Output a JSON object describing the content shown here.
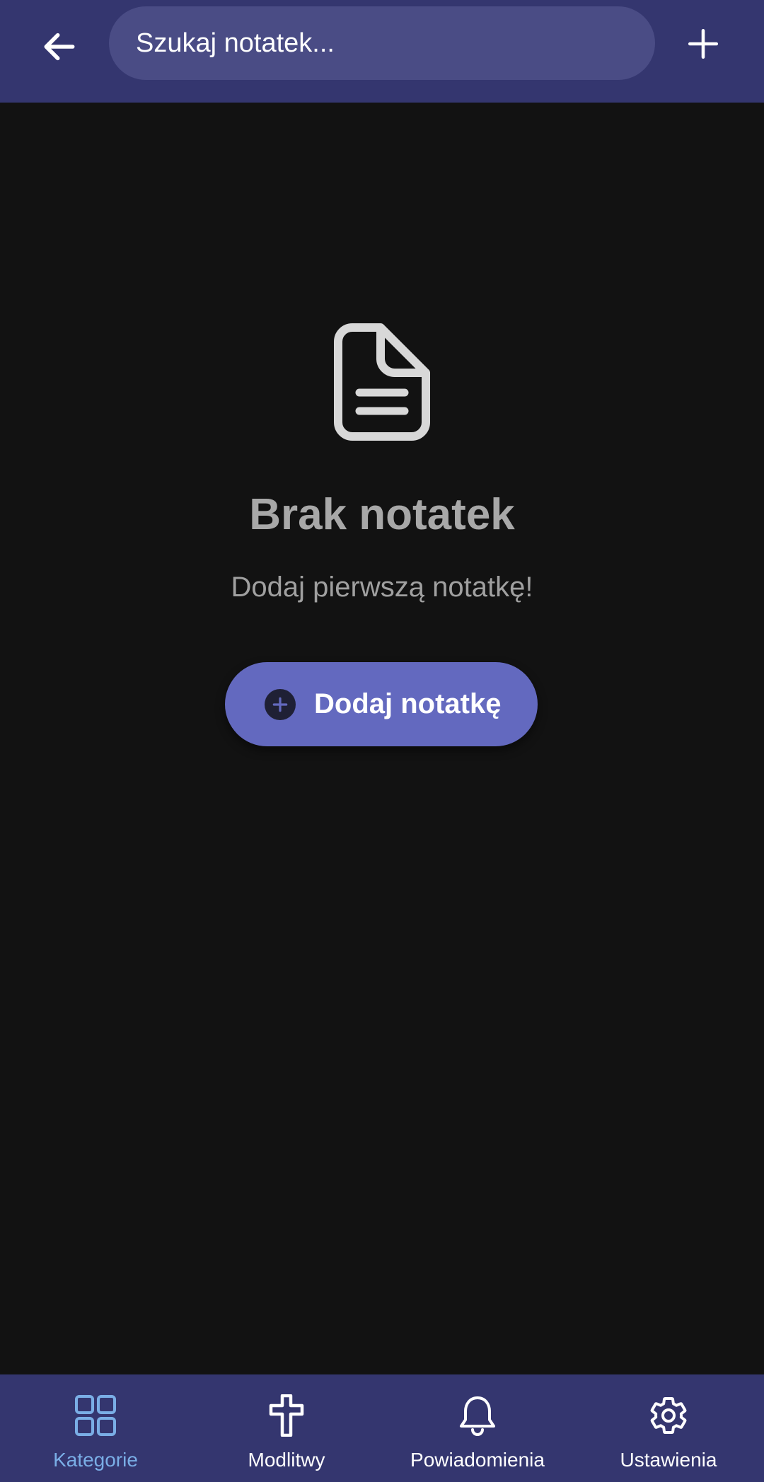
{
  "header": {
    "search_placeholder": "Szukaj notatek...",
    "background": "#34366f",
    "search_background": "#4a4c85",
    "icons": {
      "back": "arrow-left-icon",
      "add": "plus-icon"
    }
  },
  "empty_state": {
    "icon": "document-icon",
    "title": "Brak notatek",
    "subtitle": "Dodaj pierwszą notatkę!",
    "button_label": "Dodaj notatkę",
    "button_color": "#6369bf"
  },
  "bottom_nav": {
    "active_color": "#7aaee6",
    "items": [
      {
        "label": "Kategorie",
        "icon": "grid-icon",
        "active": true
      },
      {
        "label": "Modlitwy",
        "icon": "cross-icon",
        "active": false
      },
      {
        "label": "Powiadomienia",
        "icon": "bell-icon",
        "active": false
      },
      {
        "label": "Ustawienia",
        "icon": "gear-icon",
        "active": false
      }
    ]
  }
}
